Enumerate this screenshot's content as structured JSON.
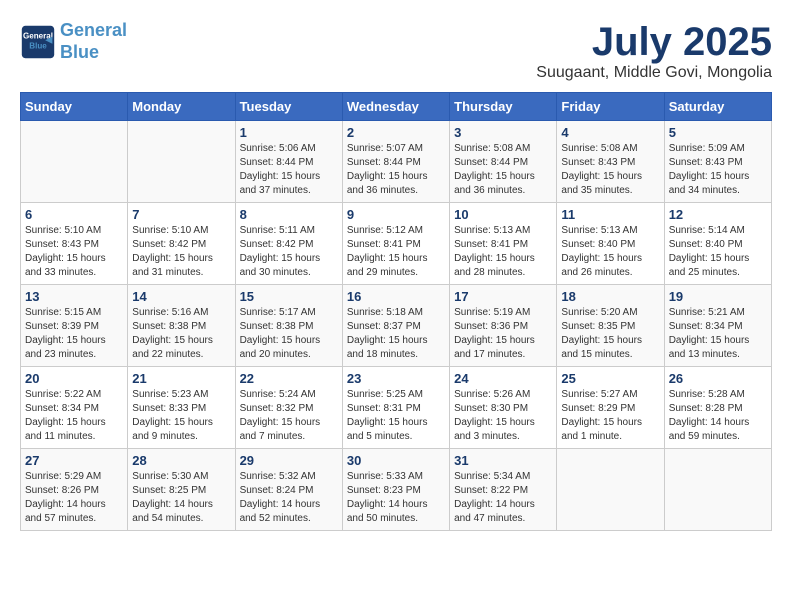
{
  "header": {
    "logo_line1": "General",
    "logo_line2": "Blue",
    "month_year": "July 2025",
    "location": "Suugaant, Middle Govi, Mongolia"
  },
  "weekdays": [
    "Sunday",
    "Monday",
    "Tuesday",
    "Wednesday",
    "Thursday",
    "Friday",
    "Saturday"
  ],
  "weeks": [
    [
      {
        "day": "",
        "sunrise": "",
        "sunset": "",
        "daylight": ""
      },
      {
        "day": "",
        "sunrise": "",
        "sunset": "",
        "daylight": ""
      },
      {
        "day": "1",
        "sunrise": "Sunrise: 5:06 AM",
        "sunset": "Sunset: 8:44 PM",
        "daylight": "Daylight: 15 hours and 37 minutes."
      },
      {
        "day": "2",
        "sunrise": "Sunrise: 5:07 AM",
        "sunset": "Sunset: 8:44 PM",
        "daylight": "Daylight: 15 hours and 36 minutes."
      },
      {
        "day": "3",
        "sunrise": "Sunrise: 5:08 AM",
        "sunset": "Sunset: 8:44 PM",
        "daylight": "Daylight: 15 hours and 36 minutes."
      },
      {
        "day": "4",
        "sunrise": "Sunrise: 5:08 AM",
        "sunset": "Sunset: 8:43 PM",
        "daylight": "Daylight: 15 hours and 35 minutes."
      },
      {
        "day": "5",
        "sunrise": "Sunrise: 5:09 AM",
        "sunset": "Sunset: 8:43 PM",
        "daylight": "Daylight: 15 hours and 34 minutes."
      }
    ],
    [
      {
        "day": "6",
        "sunrise": "Sunrise: 5:10 AM",
        "sunset": "Sunset: 8:43 PM",
        "daylight": "Daylight: 15 hours and 33 minutes."
      },
      {
        "day": "7",
        "sunrise": "Sunrise: 5:10 AM",
        "sunset": "Sunset: 8:42 PM",
        "daylight": "Daylight: 15 hours and 31 minutes."
      },
      {
        "day": "8",
        "sunrise": "Sunrise: 5:11 AM",
        "sunset": "Sunset: 8:42 PM",
        "daylight": "Daylight: 15 hours and 30 minutes."
      },
      {
        "day": "9",
        "sunrise": "Sunrise: 5:12 AM",
        "sunset": "Sunset: 8:41 PM",
        "daylight": "Daylight: 15 hours and 29 minutes."
      },
      {
        "day": "10",
        "sunrise": "Sunrise: 5:13 AM",
        "sunset": "Sunset: 8:41 PM",
        "daylight": "Daylight: 15 hours and 28 minutes."
      },
      {
        "day": "11",
        "sunrise": "Sunrise: 5:13 AM",
        "sunset": "Sunset: 8:40 PM",
        "daylight": "Daylight: 15 hours and 26 minutes."
      },
      {
        "day": "12",
        "sunrise": "Sunrise: 5:14 AM",
        "sunset": "Sunset: 8:40 PM",
        "daylight": "Daylight: 15 hours and 25 minutes."
      }
    ],
    [
      {
        "day": "13",
        "sunrise": "Sunrise: 5:15 AM",
        "sunset": "Sunset: 8:39 PM",
        "daylight": "Daylight: 15 hours and 23 minutes."
      },
      {
        "day": "14",
        "sunrise": "Sunrise: 5:16 AM",
        "sunset": "Sunset: 8:38 PM",
        "daylight": "Daylight: 15 hours and 22 minutes."
      },
      {
        "day": "15",
        "sunrise": "Sunrise: 5:17 AM",
        "sunset": "Sunset: 8:38 PM",
        "daylight": "Daylight: 15 hours and 20 minutes."
      },
      {
        "day": "16",
        "sunrise": "Sunrise: 5:18 AM",
        "sunset": "Sunset: 8:37 PM",
        "daylight": "Daylight: 15 hours and 18 minutes."
      },
      {
        "day": "17",
        "sunrise": "Sunrise: 5:19 AM",
        "sunset": "Sunset: 8:36 PM",
        "daylight": "Daylight: 15 hours and 17 minutes."
      },
      {
        "day": "18",
        "sunrise": "Sunrise: 5:20 AM",
        "sunset": "Sunset: 8:35 PM",
        "daylight": "Daylight: 15 hours and 15 minutes."
      },
      {
        "day": "19",
        "sunrise": "Sunrise: 5:21 AM",
        "sunset": "Sunset: 8:34 PM",
        "daylight": "Daylight: 15 hours and 13 minutes."
      }
    ],
    [
      {
        "day": "20",
        "sunrise": "Sunrise: 5:22 AM",
        "sunset": "Sunset: 8:34 PM",
        "daylight": "Daylight: 15 hours and 11 minutes."
      },
      {
        "day": "21",
        "sunrise": "Sunrise: 5:23 AM",
        "sunset": "Sunset: 8:33 PM",
        "daylight": "Daylight: 15 hours and 9 minutes."
      },
      {
        "day": "22",
        "sunrise": "Sunrise: 5:24 AM",
        "sunset": "Sunset: 8:32 PM",
        "daylight": "Daylight: 15 hours and 7 minutes."
      },
      {
        "day": "23",
        "sunrise": "Sunrise: 5:25 AM",
        "sunset": "Sunset: 8:31 PM",
        "daylight": "Daylight: 15 hours and 5 minutes."
      },
      {
        "day": "24",
        "sunrise": "Sunrise: 5:26 AM",
        "sunset": "Sunset: 8:30 PM",
        "daylight": "Daylight: 15 hours and 3 minutes."
      },
      {
        "day": "25",
        "sunrise": "Sunrise: 5:27 AM",
        "sunset": "Sunset: 8:29 PM",
        "daylight": "Daylight: 15 hours and 1 minute."
      },
      {
        "day": "26",
        "sunrise": "Sunrise: 5:28 AM",
        "sunset": "Sunset: 8:28 PM",
        "daylight": "Daylight: 14 hours and 59 minutes."
      }
    ],
    [
      {
        "day": "27",
        "sunrise": "Sunrise: 5:29 AM",
        "sunset": "Sunset: 8:26 PM",
        "daylight": "Daylight: 14 hours and 57 minutes."
      },
      {
        "day": "28",
        "sunrise": "Sunrise: 5:30 AM",
        "sunset": "Sunset: 8:25 PM",
        "daylight": "Daylight: 14 hours and 54 minutes."
      },
      {
        "day": "29",
        "sunrise": "Sunrise: 5:32 AM",
        "sunset": "Sunset: 8:24 PM",
        "daylight": "Daylight: 14 hours and 52 minutes."
      },
      {
        "day": "30",
        "sunrise": "Sunrise: 5:33 AM",
        "sunset": "Sunset: 8:23 PM",
        "daylight": "Daylight: 14 hours and 50 minutes."
      },
      {
        "day": "31",
        "sunrise": "Sunrise: 5:34 AM",
        "sunset": "Sunset: 8:22 PM",
        "daylight": "Daylight: 14 hours and 47 minutes."
      },
      {
        "day": "",
        "sunrise": "",
        "sunset": "",
        "daylight": ""
      },
      {
        "day": "",
        "sunrise": "",
        "sunset": "",
        "daylight": ""
      }
    ]
  ]
}
